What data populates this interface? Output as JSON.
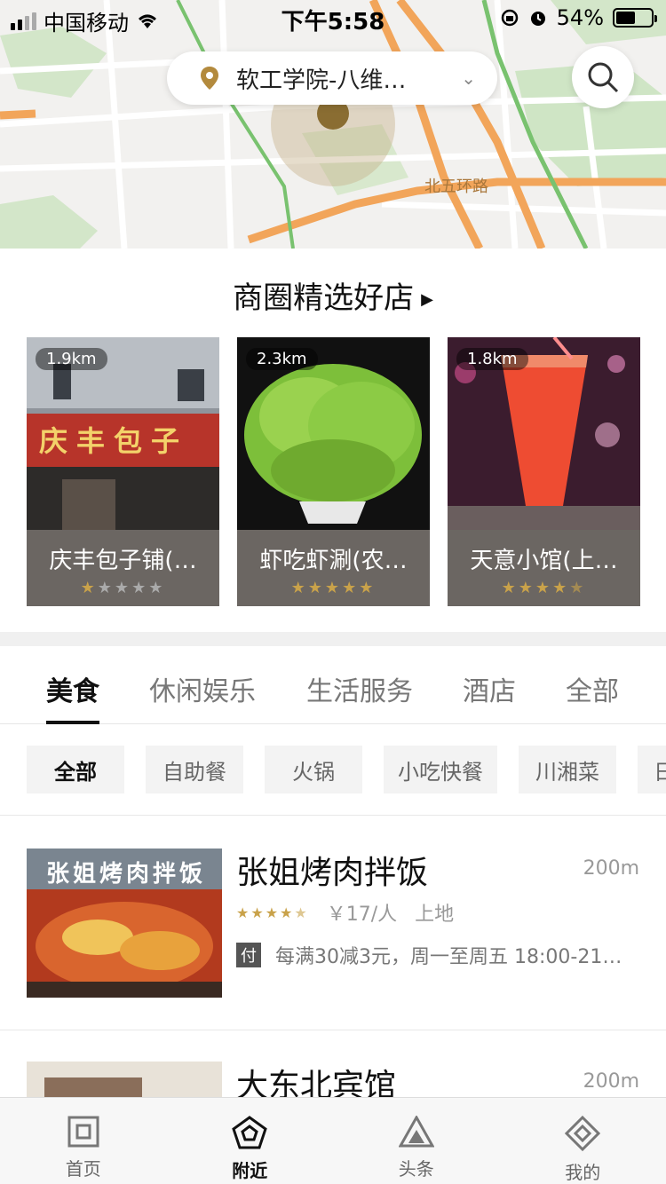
{
  "status_bar": {
    "carrier": "中国移动",
    "time": "下午5:58",
    "battery": "54%"
  },
  "map": {
    "location_text": "软工学院-八维…",
    "road_label": "北五环路"
  },
  "featured": {
    "title": "商圈精选好店",
    "cards": [
      {
        "distance": "1.9km",
        "name": "庆丰包子铺(…",
        "rating": 1,
        "sign_text": "庆丰包子"
      },
      {
        "distance": "2.3km",
        "name": "虾吃虾涮(农…",
        "rating": 5
      },
      {
        "distance": "1.8km",
        "name": "天意小馆(上…",
        "rating": 4.5
      }
    ]
  },
  "tabs": [
    "美食",
    "休闲娱乐",
    "生活服务",
    "酒店",
    "全部"
  ],
  "chips": [
    "全部",
    "自助餐",
    "火锅",
    "小吃快餐",
    "川湘菜",
    "日"
  ],
  "list": [
    {
      "title": "张姐烤肉拌饭",
      "distance": "200m",
      "rating": 4.5,
      "price": "￥17/人",
      "area": "上地",
      "promo_tag": "付",
      "promo": "每满30减3元，周一至周五 18:00-21…",
      "thumb_text": "张姐烤肉拌饭"
    },
    {
      "title": "大东北宾馆",
      "distance": "200m"
    }
  ],
  "bottom_nav": [
    {
      "label": "首页",
      "icon": "home-icon"
    },
    {
      "label": "附近",
      "icon": "nearby-icon"
    },
    {
      "label": "头条",
      "icon": "headlines-icon"
    },
    {
      "label": "我的",
      "icon": "profile-icon"
    }
  ],
  "colors": {
    "accent_gold": "#c9a24a",
    "road_orange": "#f2a55a",
    "park_green": "#cfe5c5"
  }
}
